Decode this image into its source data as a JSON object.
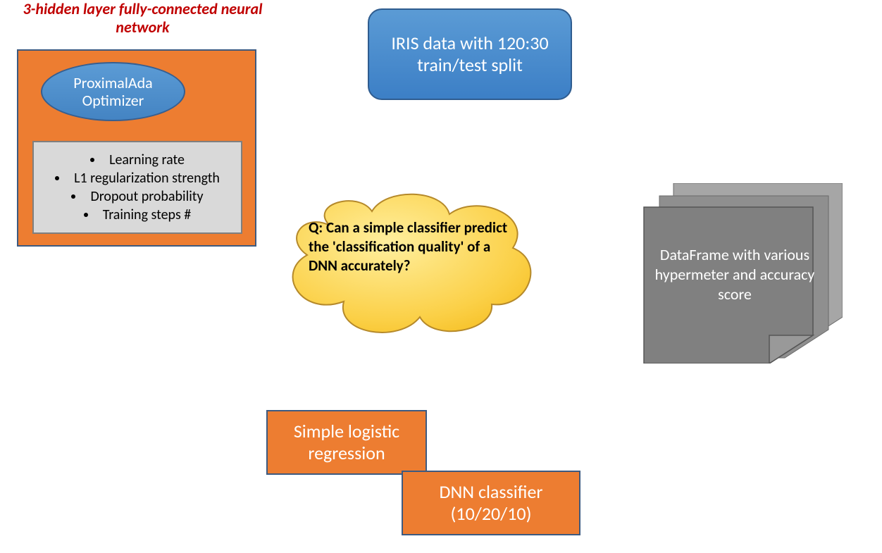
{
  "nn_title": "3-hidden layer fully-connected neural network",
  "optimizer_label": "ProximalAda Optimizer",
  "params": [
    "Learning rate",
    "L1 regularization strength",
    "Dropout probability",
    "Training steps #"
  ],
  "iris_box": "IRIS data with 120:30 train/test split",
  "cloud": {
    "lead": "Q:",
    "body": " Can a simple classifier predict the 'classification quality' of a DNN accurately?"
  },
  "dataframe_box": "DataFrame with various hypermeter and accuracy score",
  "bottom_box_1": "Simple logistic regression",
  "bottom_box_2": "DNN classifier (10/20/10)"
}
